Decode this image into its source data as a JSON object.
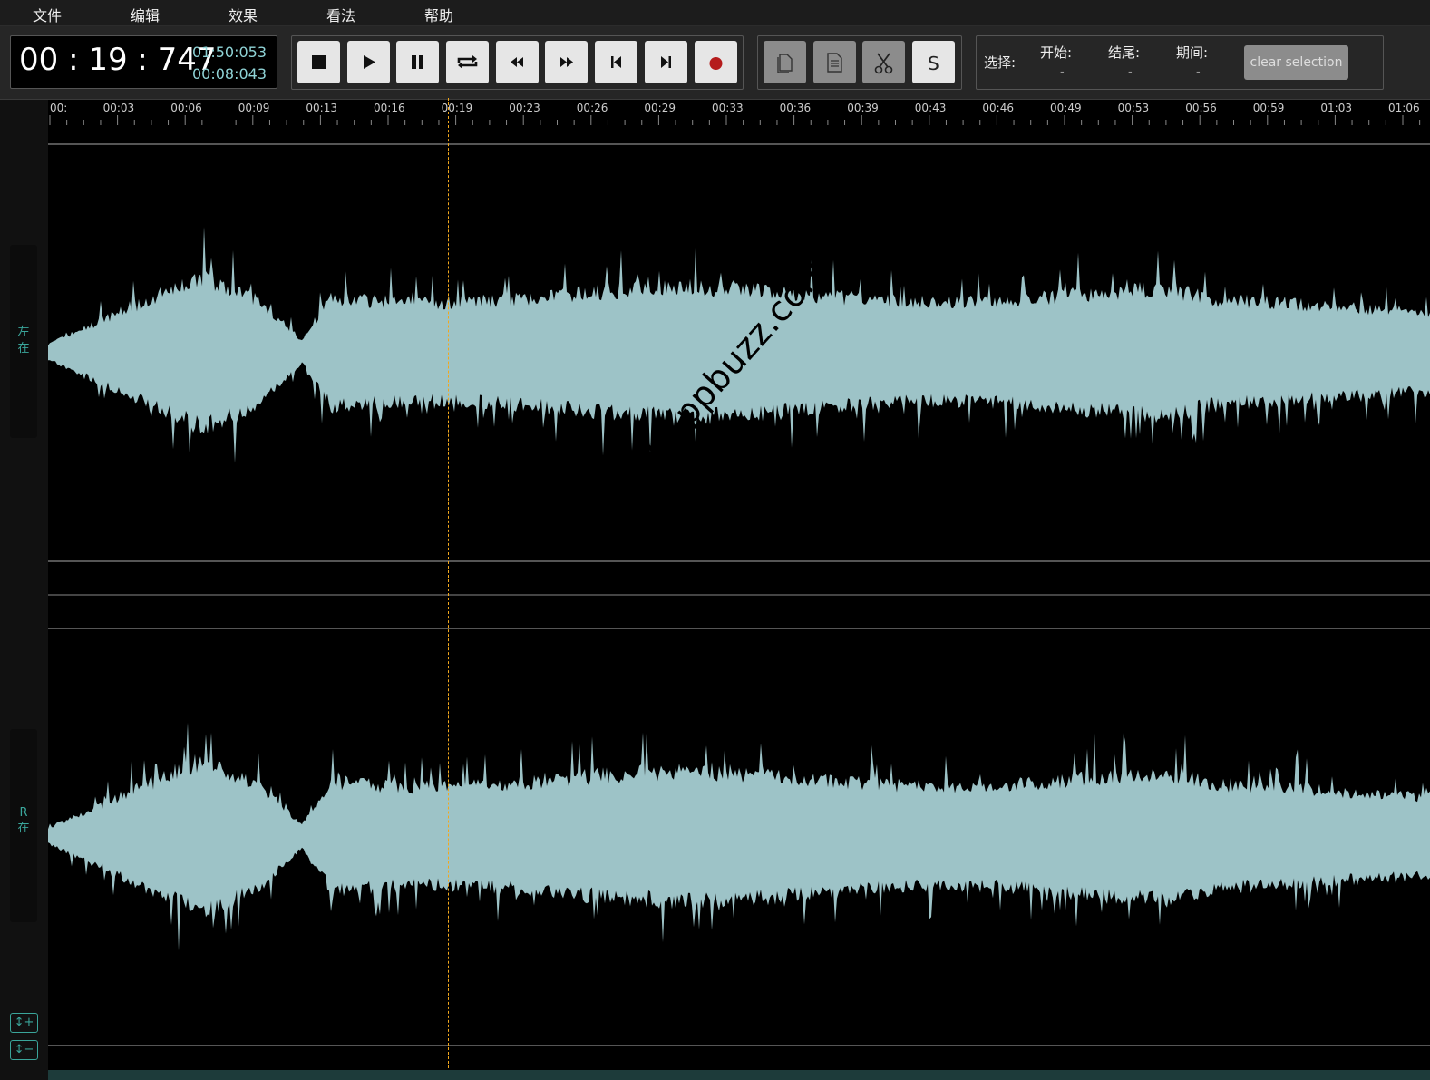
{
  "menu": {
    "items": [
      "文件",
      "编辑",
      "效果",
      "看法",
      "帮助"
    ]
  },
  "time": {
    "current": "00 : 19 : 747",
    "total": "01:50:053",
    "selection_length": "00:08:043"
  },
  "transport": {
    "buttons": [
      "stop-icon",
      "play-icon",
      "pause-icon",
      "loop-icon",
      "rewind-icon",
      "fast-forward-icon",
      "skip-to-start-icon",
      "skip-to-end-icon",
      "record-icon"
    ]
  },
  "edit_tools": {
    "buttons": [
      "copy-icon",
      "paste-icon",
      "cut-icon",
      "s"
    ],
    "s_label": "S"
  },
  "selection": {
    "label": "选择:",
    "start_label": "开始:",
    "end_label": "结尾:",
    "duration_label": "期间:",
    "start_value": "-",
    "end_value": "-",
    "duration_value": "-",
    "clear_label": "clear selection"
  },
  "ruler": {
    "ticks": [
      "00:",
      "00:03",
      "00:06",
      "00:09",
      "00:13",
      "00:16",
      "00:19",
      "00:23",
      "00:26",
      "00:29",
      "00:33",
      "00:36",
      "00:39",
      "00:43",
      "00:46",
      "00:49",
      "00:53",
      "00:56",
      "00:59",
      "01:03",
      "01:06"
    ]
  },
  "channels": {
    "left": {
      "line1": "左",
      "line2": "在"
    },
    "right": {
      "line1": "R",
      "line2": "在"
    }
  },
  "zoom": {
    "in_label": "↕+",
    "out_label": "↕−"
  },
  "watermark": "www.ppbuzz.com",
  "colors": {
    "waveform": "#9dc3c7",
    "playhead": "#f2a81d",
    "accent": "#3aa59a",
    "record": "#b51c1c"
  }
}
